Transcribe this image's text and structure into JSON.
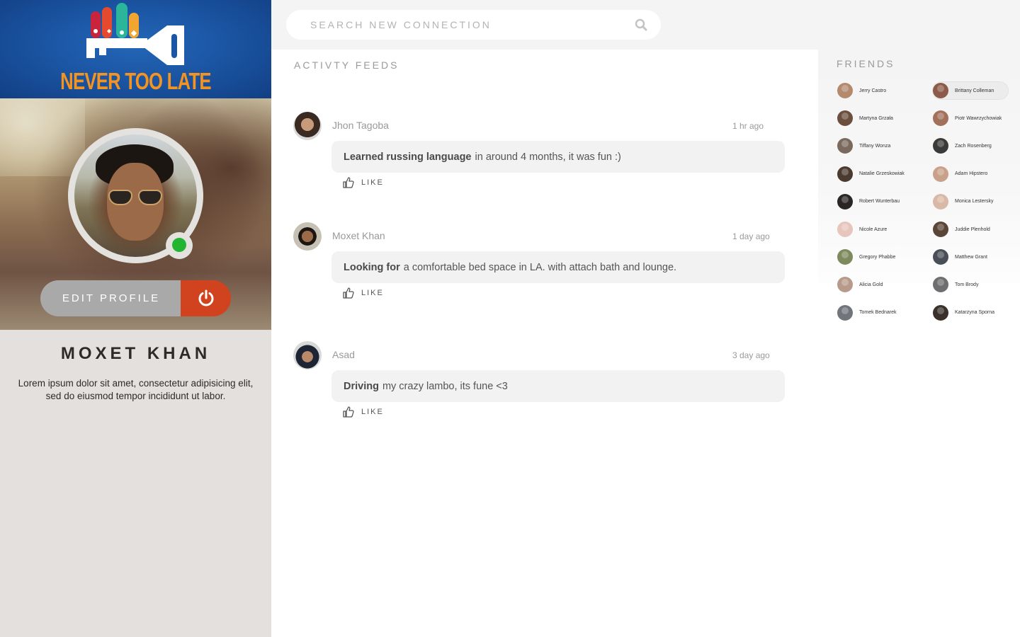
{
  "brand": {
    "logo_text": "NEVER TOO LATE"
  },
  "profile": {
    "name": "MOXET KHAN",
    "bio": "Lorem ipsum dolor sit amet, consectetur adipisicing elit, sed do eiusmod tempor incididunt ut labor.",
    "edit_label": "EDIT PROFILE",
    "status": "online"
  },
  "search": {
    "placeholder": "SEARCH NEW CONNECTION",
    "value": ""
  },
  "feed": {
    "title": "ACTIVTY FEEDS",
    "like_label": "LIKE",
    "posts": [
      {
        "author": "Jhon Tagoba",
        "time": "1 hr ago",
        "bold": "Learned russing language",
        "text": "in around 4 months, it was fun :)"
      },
      {
        "author": "Moxet Khan",
        "time": "1 day ago",
        "bold": "Looking for",
        "text": "a comfortable bed space in LA. with attach bath and lounge."
      },
      {
        "author": "Asad",
        "time": "3 day ago",
        "bold": "Driving",
        "text": "my crazy lambo, its fune <3"
      }
    ]
  },
  "friends": {
    "title": "FRIENDS",
    "items": [
      {
        "name": "Jerry Castro",
        "active": false
      },
      {
        "name": "Brittany Colleman",
        "active": true
      },
      {
        "name": "Martyna Grzała",
        "active": false
      },
      {
        "name": "Piotr Wawrzychowiak",
        "active": false
      },
      {
        "name": "Tiffany Wonza",
        "active": false
      },
      {
        "name": "Zach Rosenberg",
        "active": false
      },
      {
        "name": "Natalie Grzeskowiak",
        "active": false
      },
      {
        "name": "Adam Hipstero",
        "active": false
      },
      {
        "name": "Robert Wunterbau",
        "active": false
      },
      {
        "name": "Monica Lestersky",
        "active": false
      },
      {
        "name": "Nicole Azure",
        "active": false
      },
      {
        "name": "Juddie Plenhold",
        "active": false
      },
      {
        "name": "Gregory Phabbe",
        "active": false
      },
      {
        "name": "Matthew Grant",
        "active": false
      },
      {
        "name": "Alicia Gold",
        "active": false
      },
      {
        "name": "Tom Brody",
        "active": false
      },
      {
        "name": "Tomek Bednarek",
        "active": false
      },
      {
        "name": "Katarzyna Sporna",
        "active": false
      }
    ]
  },
  "colors": {
    "accent_orange": "#f39321",
    "power_red": "#d1431f",
    "online_green": "#22b532",
    "sidebar_bg": "#e3e0de",
    "brand_blue": "#1b56a4"
  },
  "icons": {
    "search": "search-icon",
    "power": "power-icon",
    "like": "thumbs-up-icon"
  }
}
